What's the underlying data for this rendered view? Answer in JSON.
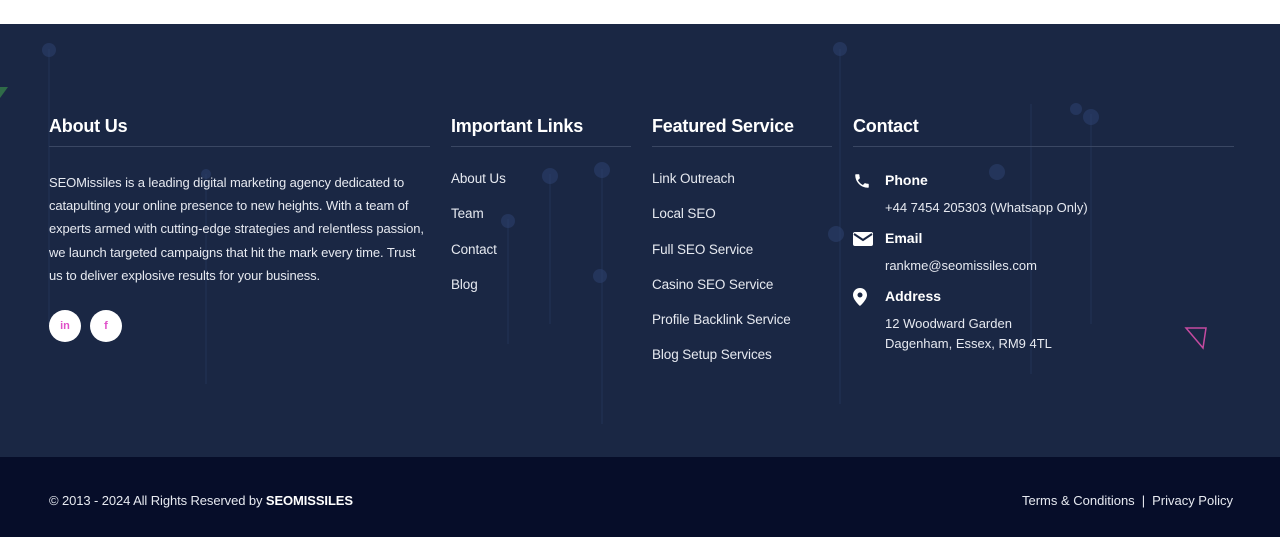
{
  "about": {
    "heading": "About Us",
    "text": "SEOMissiles is a leading digital marketing agency dedicated to catapulting your online presence to new heights. With a team of experts armed with cutting-edge strategies and relentless passion, we launch targeted campaigns that hit the mark every time. Trust us to deliver explosive results for your business.",
    "socials": [
      {
        "label": "in",
        "icon": "linkedin-icon"
      },
      {
        "label": "f",
        "icon": "facebook-icon"
      }
    ]
  },
  "links": {
    "heading": "Important Links",
    "items": [
      "About Us",
      "Team",
      "Contact",
      "Blog"
    ]
  },
  "services": {
    "heading": "Featured Service",
    "items": [
      "Link Outreach",
      "Local SEO",
      "Full SEO Service",
      "Casino SEO Service",
      "Profile Backlink Service",
      "Blog Setup Services"
    ]
  },
  "contact": {
    "heading": "Contact",
    "phone_label": "Phone",
    "phone_value": "+44 7454 205303 (Whatsapp Only)",
    "email_label": "Email",
    "email_value": "rankme@seomissiles.com",
    "address_label": "Address",
    "address_line1": "12 Woodward Garden",
    "address_line2": "Dagenham, Essex, RM9 4TL"
  },
  "bottom": {
    "copyright_prefix": "© 2013 - 2024 All Rights Reserved by ",
    "brand": "SEOMISSILES",
    "terms": "Terms & Conditions",
    "separator": "|",
    "privacy": "Privacy Policy"
  },
  "colors": {
    "footer_bg": "#1a2744",
    "bottom_bg": "#060d29",
    "accent_pink": "#e04fc9",
    "text": "#e6e9f0"
  }
}
